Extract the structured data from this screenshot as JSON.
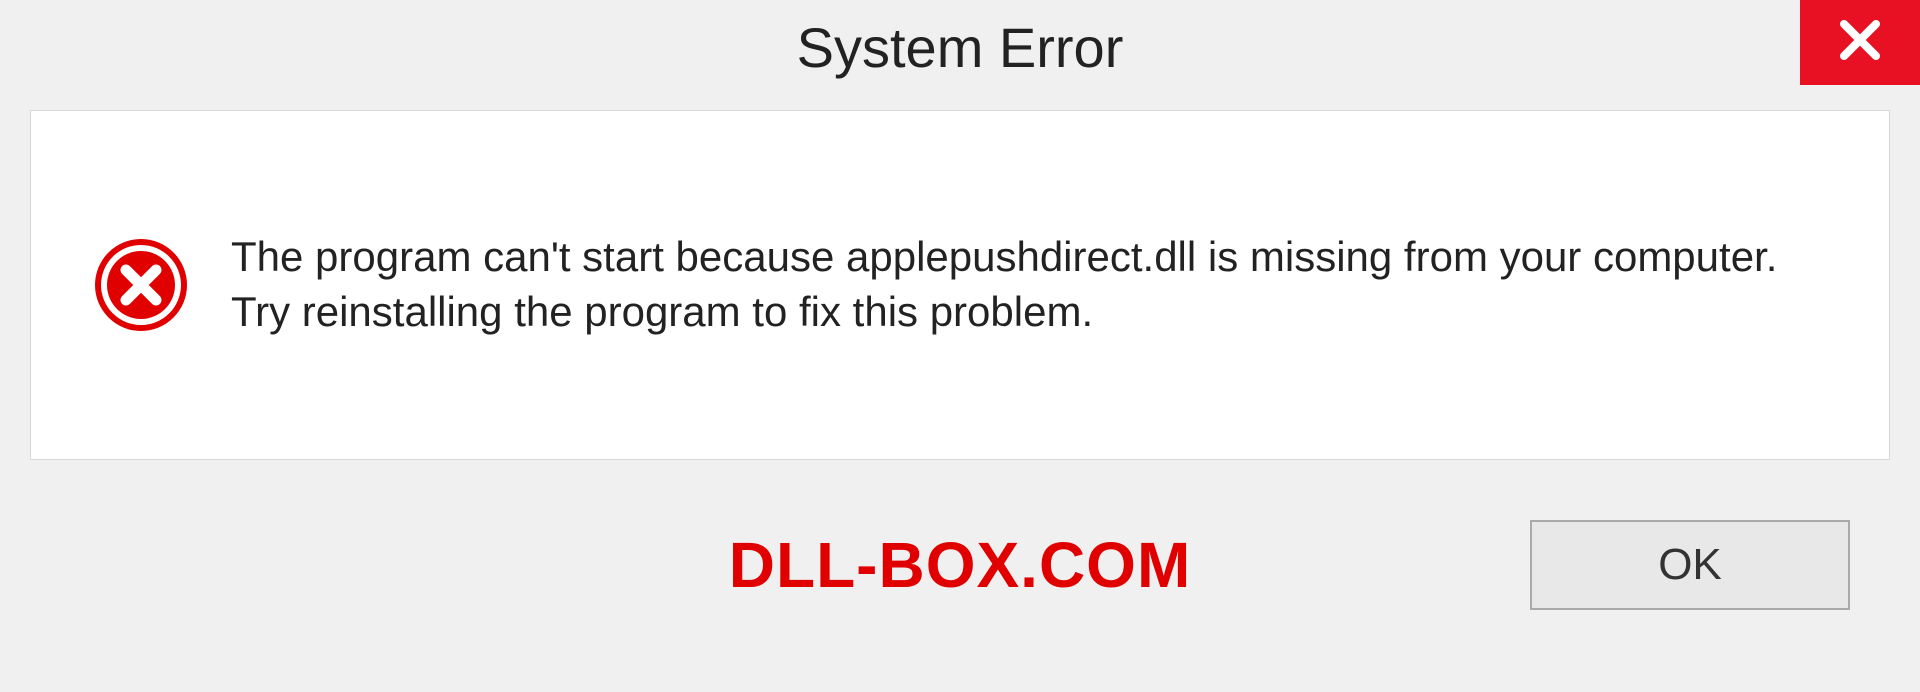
{
  "dialog": {
    "title": "System Error",
    "close_label": "Close",
    "message": "The program can't start because applepushdirect.dll is missing from your computer. Try reinstalling the program to fix this problem.",
    "ok_label": "OK"
  },
  "watermark": "DLL-BOX.COM",
  "colors": {
    "close_bg": "#e81123",
    "error_red": "#e00000"
  }
}
